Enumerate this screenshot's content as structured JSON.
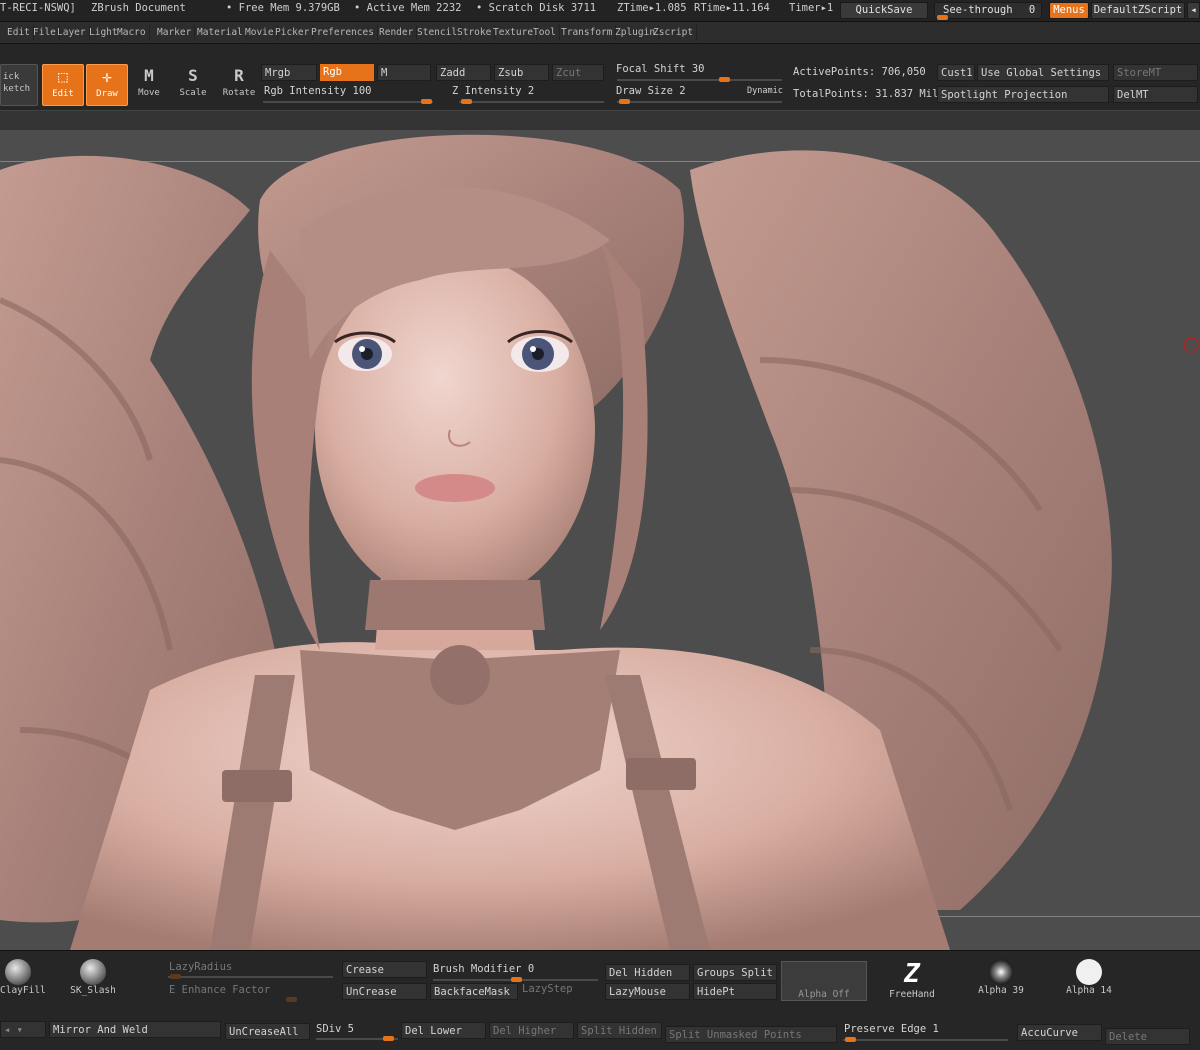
{
  "titlebar": {
    "doc_id": "T-RECI-NSWQ]",
    "app_title": "ZBrush Document",
    "free_mem": "• Free Mem 9.379GB",
    "active_mem": "• Active Mem 2232",
    "scratch": "• Scratch Disk 3711",
    "ztime": "ZTime▸1.085",
    "rtime": "RTime▸11.164",
    "timer": "Timer▸1",
    "quicksave": "QuickSave",
    "seethrough": "See-through",
    "seethrough_value": "0",
    "menus": "Menus",
    "script": "DefaultZScript",
    "scroll_arrow": "◂"
  },
  "menubar": [
    "Edit",
    "File",
    "Layer",
    "Light",
    "Macro",
    "Marker",
    "Material",
    "Movie",
    "Picker",
    "Preferences",
    "Render",
    "Stencil",
    "Stroke",
    "Texture",
    "Tool",
    "Transform",
    "Zplugin",
    "Zscript"
  ],
  "toolbar": {
    "sketch_line1": "ick",
    "sketch_line2": "ketch",
    "edit": "Edit",
    "draw": "Draw",
    "move": "Move",
    "scale": "Scale",
    "rotate": "Rotate",
    "move_glyph": "M",
    "scale_glyph": "S",
    "rotate_glyph": "R",
    "mrgb": "Mrgb",
    "rgb": "Rgb",
    "m": "M",
    "zadd": "Zadd",
    "zsub": "Zsub",
    "zcut": "Zcut",
    "rgb_intensity": "Rgb Intensity 100",
    "z_intensity": "Z Intensity 2",
    "focal_shift": "Focal Shift 30",
    "draw_size": "Draw Size 2",
    "dynamic": "Dynamic",
    "active_points": "ActivePoints: 706,050",
    "total_points": "TotalPoints: 31.837 Mil",
    "cust1": "Cust1",
    "use_global": "Use Global Settings",
    "storemt": "StoreMT",
    "spotlight": "Spotlight Projection",
    "delmt": "DelMT"
  },
  "shelf": {
    "clayfill": "ClayFill",
    "sk_slash": "SK_Slash",
    "lazyradius": "LazyRadius",
    "enhance": "E Enhance Factor",
    "crease": "Crease",
    "uncrease": "UnCrease",
    "brush_modifier": "Brush Modifier 0",
    "backfacemask": "BackfaceMask",
    "lazystep": "LazyStep",
    "del_hidden": "Del Hidden",
    "lazymouse": "LazyMouse",
    "groups_split": "Groups Split",
    "hidept": "HidePt",
    "alpha_off": "Alpha Off",
    "freehand": "FreeHand",
    "alpha39": "Alpha 39",
    "alpha14": "Alpha 14",
    "mirror_weld": "Mirror And Weld",
    "uncreaseall": "UnCreaseAll",
    "sdiv": "SDiv 5",
    "del_lower": "Del Lower",
    "del_higher": "Del Higher",
    "split_hidden": "Split Hidden",
    "split_unmasked": "Split Unmasked Points",
    "preserve_edge": "Preserve Edge 1",
    "accucurve": "AccuCurve",
    "delete": "Delete"
  },
  "sliders": {
    "rgb_intensity": 1.0,
    "z_intensity": 0.02,
    "focal_shift": 0.3,
    "draw_size": 0.02,
    "sdiv": 0.7,
    "preserve_edge": 0.02
  },
  "colors": {
    "accent": "#e6731a",
    "canvas_bg": "#4d4d4d",
    "clay": "#b28b80"
  }
}
